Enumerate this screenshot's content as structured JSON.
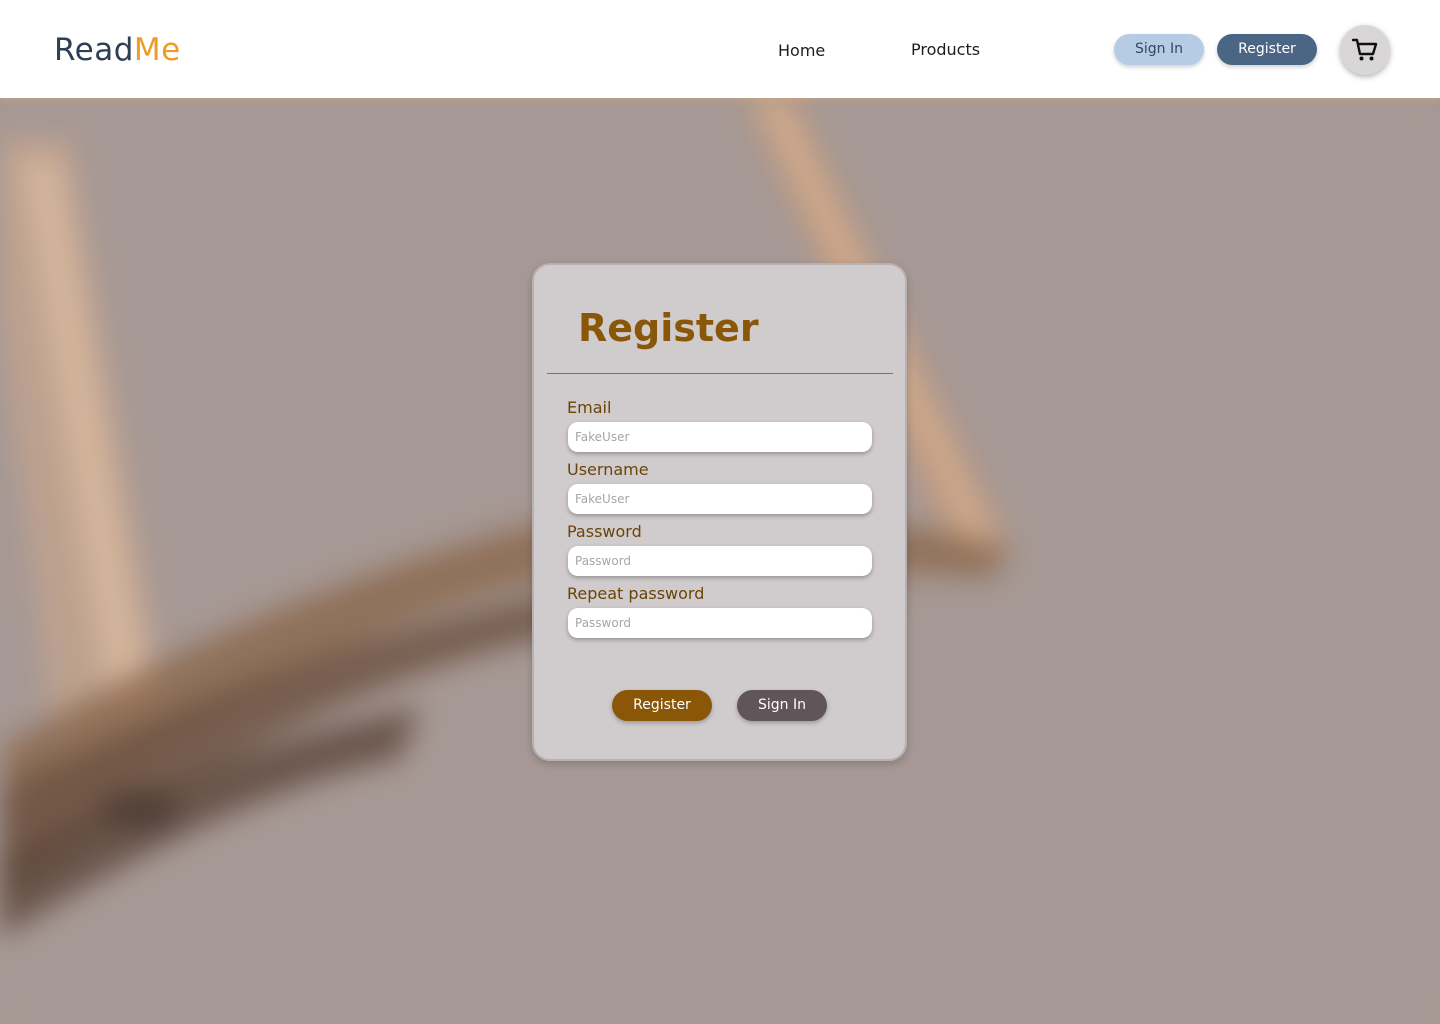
{
  "header": {
    "logo_part1": "Read",
    "logo_part2": "Me",
    "nav": {
      "home": "Home",
      "products": "Products"
    },
    "sign_in_label": "Sign In",
    "register_label": "Register",
    "cart_icon": "cart-icon"
  },
  "form": {
    "title": "Register",
    "fields": [
      {
        "label": "Email",
        "placeholder": "FakeUser",
        "value": ""
      },
      {
        "label": "Username",
        "placeholder": "FakeUser",
        "value": ""
      },
      {
        "label": "Password",
        "placeholder": "Password",
        "value": ""
      },
      {
        "label": "Repeat password",
        "placeholder": "Password",
        "value": ""
      }
    ],
    "register_label": "Register",
    "sign_in_label": "Sign In"
  },
  "colors": {
    "brand_dark": "#2e3e55",
    "brand_accent": "#ef9c22",
    "primary_brown": "#8a5608",
    "nav_register": "#4b6584",
    "nav_sign_in": "#b6cbe4"
  }
}
